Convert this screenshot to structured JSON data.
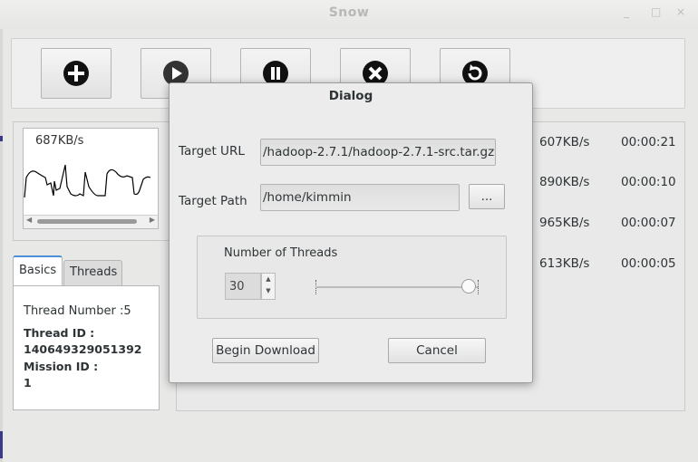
{
  "window": {
    "title": "Snow",
    "controls": [
      "_",
      "□",
      "×"
    ]
  },
  "toolbar": {
    "buttons": [
      {
        "name": "add",
        "icon": "plus-circle-icon"
      },
      {
        "name": "start",
        "icon": "play-circle-icon"
      },
      {
        "name": "pause",
        "icon": "pause-circle-icon"
      },
      {
        "name": "cancel",
        "icon": "close-circle-icon"
      },
      {
        "name": "refresh",
        "icon": "refresh-circle-icon"
      }
    ]
  },
  "speed_graph": {
    "current_speed": "687KB/s"
  },
  "tabs": {
    "items": [
      {
        "label": "Basics"
      },
      {
        "label": "Threads"
      }
    ],
    "active": 0
  },
  "basics": {
    "thread_number": "Thread Number :5",
    "thread_id_label": "Thread ID :",
    "thread_id_value": "140649329051392",
    "mission_id_label": "Mission ID :",
    "mission_id_value": "1"
  },
  "downloads": {
    "rows": [
      {
        "speed": "607KB/s",
        "time": "00:00:21"
      },
      {
        "speed": "890KB/s",
        "time": "00:00:10"
      },
      {
        "speed": "965KB/s",
        "time": "00:00:07"
      },
      {
        "speed": "613KB/s",
        "time": "00:00:05"
      }
    ]
  },
  "dialog": {
    "title": "Dialog",
    "target_url_label": "Target URL",
    "target_url_value": "/hadoop-2.7.1/hadoop-2.7.1-src.tar.gz",
    "target_path_label": "Target Path",
    "target_path_value": "/home/kimmin",
    "browse_label": "...",
    "threads_group_label": "Number of Threads",
    "threads_value": "30",
    "threads_slider_fraction": 1.0,
    "begin_label": "Begin Download",
    "cancel_label": "Cancel"
  },
  "colors": {
    "accent": "#4a90d9",
    "side_marker": "#3a3a8c"
  }
}
